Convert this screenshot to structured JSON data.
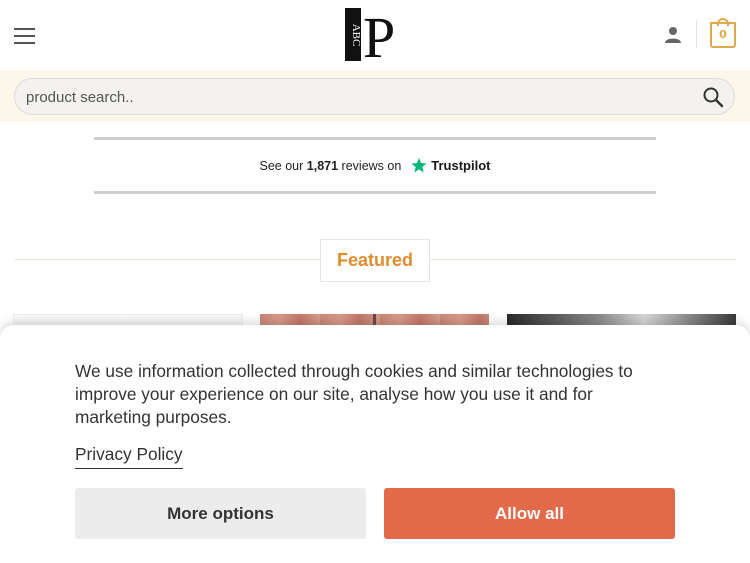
{
  "header": {
    "logo_text": "ABC",
    "logo_letter": "P",
    "cart_count": "0",
    "icons": {
      "menu": "hamburger-menu-icon",
      "account": "user-icon",
      "cart": "cart-icon"
    }
  },
  "search": {
    "placeholder": "product search..",
    "icon": "search-icon"
  },
  "trustpilot": {
    "prefix": "See our",
    "count": "1,871",
    "suffix": "reviews on",
    "brand": "Trustpilot",
    "star_color": "#00b67a"
  },
  "featured": {
    "label": "Featured",
    "accent": "#e08c2e"
  },
  "cookie_banner": {
    "message": "We use information collected through cookies and similar technologies to improve your experience on our site, analyse how you use it and for marketing purposes.",
    "privacy_link": "Privacy Policy",
    "more_options": "More options",
    "allow_all": "Allow all",
    "allow_color": "#e2694a"
  }
}
